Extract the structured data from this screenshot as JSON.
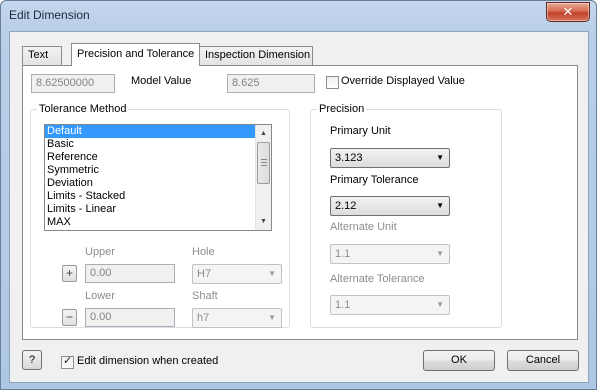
{
  "window": {
    "title": "Edit Dimension",
    "close_glyph": "✕"
  },
  "tabs": [
    {
      "label": "Text",
      "active": false
    },
    {
      "label": "Precision and Tolerance",
      "active": true
    },
    {
      "label": "Inspection Dimension",
      "active": false
    }
  ],
  "model_value": {
    "value": "8.62500000",
    "label": "Model Value",
    "displayed_value": "8.625",
    "override_label": "Override Displayed Value",
    "override_checked": false
  },
  "tolerance_method": {
    "title": "Tolerance Method",
    "items": [
      "Default",
      "Basic",
      "Reference",
      "Symmetric",
      "Deviation",
      "Limits - Stacked",
      "Limits - Linear",
      "MAX"
    ],
    "selected": "Default",
    "upper_label": "Upper",
    "upper_value": "0.00",
    "lower_label": "Lower",
    "lower_value": "0.00",
    "hole_label": "Hole",
    "hole_value": "H7",
    "shaft_label": "Shaft",
    "shaft_value": "h7",
    "plus_glyph": "+",
    "minus_glyph": "−"
  },
  "precision": {
    "title": "Precision",
    "primary_unit_label": "Primary Unit",
    "primary_unit_value": "3.123",
    "primary_tolerance_label": "Primary Tolerance",
    "primary_tolerance_value": "2.12",
    "alternate_unit_label": "Alternate Unit",
    "alternate_unit_value": "1.1",
    "alternate_tolerance_label": "Alternate Tolerance",
    "alternate_tolerance_value": "1.1"
  },
  "footer": {
    "help_glyph": "?",
    "edit_when_created_label": "Edit dimension when created",
    "edit_when_created_checked": true,
    "ok_label": "OK",
    "cancel_label": "Cancel"
  },
  "icons": {
    "dropdown": "▼",
    "scroll_up": "▲",
    "scroll_down": "▼"
  }
}
